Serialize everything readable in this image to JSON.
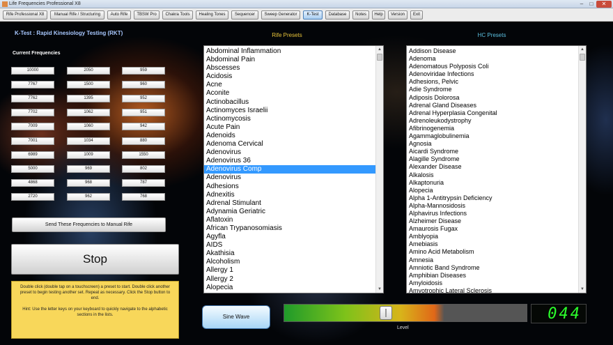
{
  "window": {
    "title": "Life Frequencies Professional X8",
    "min": "–",
    "max": "□",
    "close": "✕"
  },
  "tabs": [
    {
      "label": "Rife Professional X8"
    },
    {
      "label": "Manual Rife / Structuring"
    },
    {
      "label": "Auto Rife"
    },
    {
      "label": "TBSW Pro"
    },
    {
      "label": "Chakra Tools"
    },
    {
      "label": "Healing Tones"
    },
    {
      "label": "Sequencer"
    },
    {
      "label": "Sweep Generator"
    },
    {
      "label": "K-Test"
    },
    {
      "label": "Database"
    },
    {
      "label": "Notes"
    },
    {
      "label": "Help"
    },
    {
      "label": "Version"
    },
    {
      "label": "Exit"
    }
  ],
  "active_tab": "K-Test",
  "ktest": {
    "title": "K-Test : Rapid Kinesiology Testing (RKT)",
    "current_label": "Current Frequencies",
    "frequencies": [
      [
        "10000",
        "2050",
        "959"
      ],
      [
        "7767",
        "1500",
        "960"
      ],
      [
        "7762",
        "1395",
        "952"
      ],
      [
        "7702",
        "1062",
        "951"
      ],
      [
        "7009",
        "1060",
        "942"
      ],
      [
        "7001",
        "1034",
        "880"
      ],
      [
        "6989",
        "1009",
        "1550"
      ],
      [
        "5000",
        "969",
        "802"
      ],
      [
        "4868",
        "968",
        "787"
      ],
      [
        "2720",
        "962",
        "768"
      ]
    ],
    "send_button": "Send These Frequencies to Manual Rife",
    "stop_button": "Stop",
    "hint_line1": "Double click (double tap on a touchscreen) a preset to start. Double click another preset to begin testing another set. Repeat as necessary. Click the Stop button to end.",
    "hint_line2": "Hint: Use the letter keys on your keyboard to quickly navigate to the alphabetic sections in the lists."
  },
  "rife_presets": {
    "heading": "Rife Presets",
    "selected": "Adenovirus Comp",
    "items": [
      "Abdominal Inflammation",
      "Abdominal Pain",
      "Abscesses",
      "Acidosis",
      "Acne",
      "Aconite",
      "Actinobacillus",
      "Actinomyces Israelii",
      "Actinomycosis",
      "Acute Pain",
      "Adenoids",
      "Adenoma Cervical",
      "Adenovirus",
      "Adenovirus 36",
      "Adenovirus Comp",
      "Adenovirus",
      "Adhesions",
      "Adnexitis",
      "Adrenal Stimulant",
      "Adynamia Geriatric",
      "Aflatoxin",
      "African Trypanosomiasis",
      "Agyfla",
      "AIDS",
      "Akathisia",
      "Alcoholism",
      "Allergy 1",
      "Allergy 2",
      "Alopecia"
    ]
  },
  "hc_presets": {
    "heading": "HC Presets",
    "items": [
      "Addison Disease",
      "Adenoma",
      "Adenomatous Polyposis Coli",
      "Adenoviridae Infections",
      "Adhesions, Pelvic",
      "Adie Syndrome",
      "Adiposis Dolorosa",
      "Adrenal Gland Diseases",
      "Adrenal Hyperplasia Congenital",
      "Adrenoleukodystrophy",
      "Afibrinogenemia",
      "Agammaglobulinemia",
      "Agnosia",
      "Aicardi Syndrome",
      "Alagille Syndrome",
      "Alexander Disease",
      "Alkalosis",
      "Alkaptonuria",
      "Alopecia",
      "Alpha 1-Antitrypsin Deficiency",
      "Alpha-Mannosidosis",
      "Alphavirus Infections",
      "Alzheimer Disease",
      "Amaurosis Fugax",
      "Amblyopia",
      "Amebiasis",
      "Amino Acid Metabolism",
      "Amnesia",
      "Amniotic Band Syndrome",
      "Amphibian Diseases",
      "Amyloidosis",
      "Amyotrophic Lateral Sclerosis"
    ]
  },
  "controls": {
    "sine_button": "Sine Wave",
    "level_label": "Level",
    "level_value": 0.42,
    "level_display": "044"
  },
  "colors": {
    "accent": "#3399ff",
    "hint_bg": "#f8d75a",
    "display_green": "#2cff2c"
  }
}
